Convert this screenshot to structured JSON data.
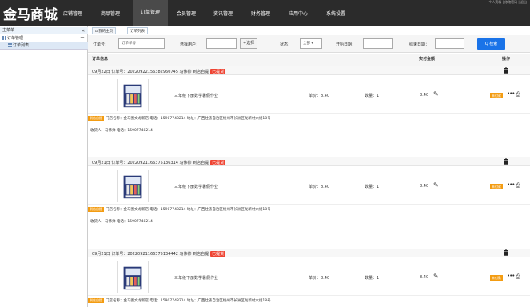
{
  "brand": "金马商城",
  "topright": "个人资料 | 修改密码 | 退出",
  "nav": [
    "店铺管理",
    "商品管理",
    "订单管理",
    "会员管理",
    "资讯管理",
    "财务管理",
    "应用中心",
    "系统设置"
  ],
  "sidebar": {
    "head": "主菜单",
    "collapse": "«",
    "group": "订单管理",
    "group_toggle": "−",
    "item": "订单列表"
  },
  "tabs": [
    "⌂ 我的主页",
    "订单列表"
  ],
  "filter": {
    "order_label": "订单号：",
    "order_placeholder": "订单单号",
    "user_label": "选择用户：",
    "select_btn": "+选择",
    "status_label": "状态：",
    "status_value": "全部 ▾",
    "start_label": "开始日期：",
    "end_label": "结束日期：",
    "search": "Q 检索"
  },
  "table": {
    "col_info": "订单信息",
    "col_paid": "实付金额",
    "col_ops": "操作"
  },
  "orders": [
    {
      "header": "09月22日 订单号：20220922156382960745 马伟帅 到店自提",
      "badge": "已提货",
      "product": "三年级下册数学暑假作业",
      "price": "单价：8.40",
      "qty": "数量：1",
      "paid": "8.40",
      "status": "未付款",
      "store_tag": "到店自提",
      "store": "门店名称：金马图文龙新店 电话：15907748214 地址：广西壮族自治区梧州市长洲区龙新村六组18号",
      "receiver": "收货人：马伟帅 电话：15907748214"
    },
    {
      "header": "09月21日 订单号：20220921166375136314 马伟帅 到店自提",
      "badge": "已提货",
      "product": "三年级下册数学暑假作业",
      "price": "单价：8.40",
      "qty": "数量：1",
      "paid": "8.40",
      "status": "未付款",
      "store_tag": "到店自提",
      "store": "门店名称：金马图文龙新店 电话：15907748214 地址：广西壮族自治区梧州市长洲区龙新村六组18号",
      "receiver": "收货人：马伟帅 电话：15907748214"
    },
    {
      "header": "09月21日 订单号：20220921166375134442 马伟帅 到店自提",
      "badge": "已提货",
      "product": "三年级下册数学暑假作业",
      "price": "单价：8.40",
      "qty": "数量：1",
      "paid": "8.40",
      "status": "未付款",
      "store_tag": "到店自提",
      "store": "门店名称：金马图文龙新店 电话：15907748214 地址：广西壮族自治区梧州市长洲区龙新村六组18号",
      "receiver": "收货人：马伟帅 电话：15907748214"
    }
  ],
  "colors": {
    "topbar": "#2b2b2b",
    "search": "#1a73e8",
    "badge": "#ee4433",
    "status": "#f39c12"
  }
}
